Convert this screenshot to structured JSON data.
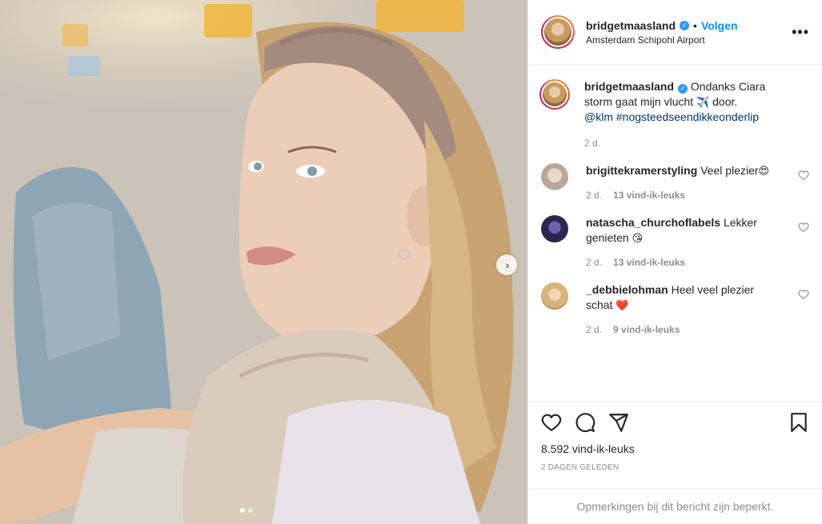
{
  "post": {
    "photo_alt_icon": "photo",
    "carousel_next_icon": "chevron-right-icon",
    "carousel_dots": 2
  },
  "header": {
    "username": "bridgetmaasland",
    "verified_icon": "verified-badge-icon",
    "bullet": "•",
    "follow_label": "Volgen",
    "location": "Amsterdam Schipohl Airport",
    "more_icon": "more-options-icon",
    "more_label": "•••"
  },
  "caption": {
    "username": "bridgetmaasland",
    "text_before": " Ondanks Ciara storm gaat mijn vlucht ",
    "emoji": "✈️",
    "text_after": " door.",
    "mention": "@klm",
    "hashtag": "#nogsteedseendikkeonderlip",
    "time": "2 d."
  },
  "comments": [
    {
      "username": "brigittekramerstyling",
      "text": " Veel plezier",
      "emoji": "😍",
      "time": "2 d.",
      "likes": "13 vind-ik-leuks"
    },
    {
      "username": "natascha_churchoflabels",
      "text": " Lekker genieten ",
      "emoji": "😘",
      "time": "2 d.",
      "likes": "13 vind-ik-leuks"
    },
    {
      "username": "_debbielohman",
      "text": " Heel veel plezier schat ",
      "emoji": "❤️",
      "time": "2 d.",
      "likes": "9 vind-ik-leuks"
    }
  ],
  "actions": {
    "like_icon": "heart-icon",
    "comment_icon": "comment-icon",
    "share_icon": "share-icon",
    "save_icon": "bookmark-icon",
    "like_count": "8.592 vind-ik-leuks",
    "date": "2 DAGEN GELEDEN",
    "restricted": "Opmerkingen bij dit bericht zijn beperkt."
  },
  "colors": {
    "follow": "#0095f6",
    "verified": "#3897f0",
    "muted": "#8e8e8e",
    "heart": "#ed4956"
  }
}
